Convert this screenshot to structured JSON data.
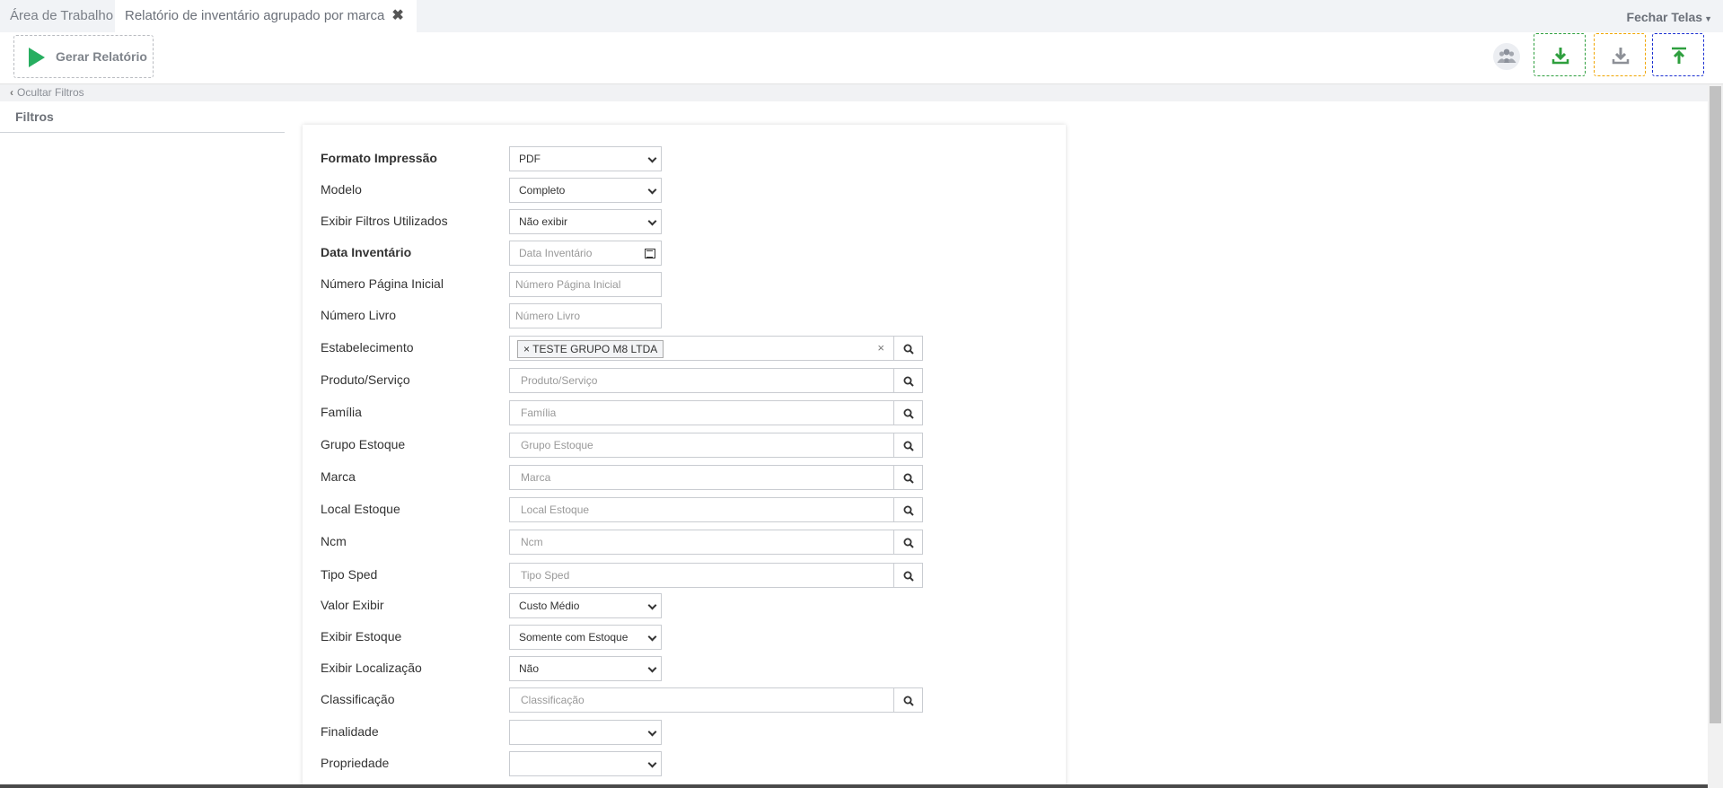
{
  "tabs": {
    "home": "Área de Trabalho",
    "active": "Relatório de inventário agrupado por marca",
    "close_glyph": "✖",
    "fechar_telas": "Fechar Telas"
  },
  "toolbar": {
    "gerar_label": "Gerar Relatório",
    "icons": [
      "users-icon",
      "download-icon",
      "download-icon",
      "upload-icon"
    ],
    "colors": {
      "play": "#27ae60",
      "green": "#2e9f3e",
      "orange": "#f0a500",
      "blue": "#1a2fd1"
    }
  },
  "sidebar": {
    "ocultar": "Ocultar Filtros",
    "title": "Filtros"
  },
  "form": {
    "formato": {
      "label": "Formato Impressão",
      "value": "PDF"
    },
    "modelo": {
      "label": "Modelo",
      "value": "Completo"
    },
    "exibir_filtros": {
      "label": "Exibir Filtros Utilizados",
      "value": "Não exibir"
    },
    "data_inventario": {
      "label": "Data Inventário",
      "placeholder": "Data Inventário"
    },
    "num_pagina": {
      "label": "Número Página Inicial",
      "placeholder": "Número Página Inicial"
    },
    "num_livro": {
      "label": "Número Livro",
      "placeholder": "Número Livro"
    },
    "estabelecimento": {
      "label": "Estabelecimento",
      "tag": "TESTE GRUPO M8 LTDA",
      "tag_remove": "×",
      "clear": "×"
    },
    "produto": {
      "label": "Produto/Serviço",
      "placeholder": "Produto/Serviço"
    },
    "familia": {
      "label": "Família",
      "placeholder": "Família"
    },
    "grupo_estoque": {
      "label": "Grupo Estoque",
      "placeholder": "Grupo Estoque"
    },
    "marca": {
      "label": "Marca",
      "placeholder": "Marca"
    },
    "local_estoque": {
      "label": "Local Estoque",
      "placeholder": "Local Estoque"
    },
    "ncm": {
      "label": "Ncm",
      "placeholder": "Ncm"
    },
    "tipo_sped": {
      "label": "Tipo Sped",
      "placeholder": "Tipo Sped"
    },
    "valor_exibir": {
      "label": "Valor Exibir",
      "value": "Custo Médio"
    },
    "exibir_estoque": {
      "label": "Exibir Estoque",
      "value": "Somente com Estoque"
    },
    "exibir_localizacao": {
      "label": "Exibir Localização",
      "value": "Não"
    },
    "classificacao": {
      "label": "Classificação",
      "placeholder": "Classificação"
    },
    "finalidade": {
      "label": "Finalidade",
      "value": ""
    },
    "propriedade": {
      "label": "Propriedade",
      "value": ""
    }
  }
}
